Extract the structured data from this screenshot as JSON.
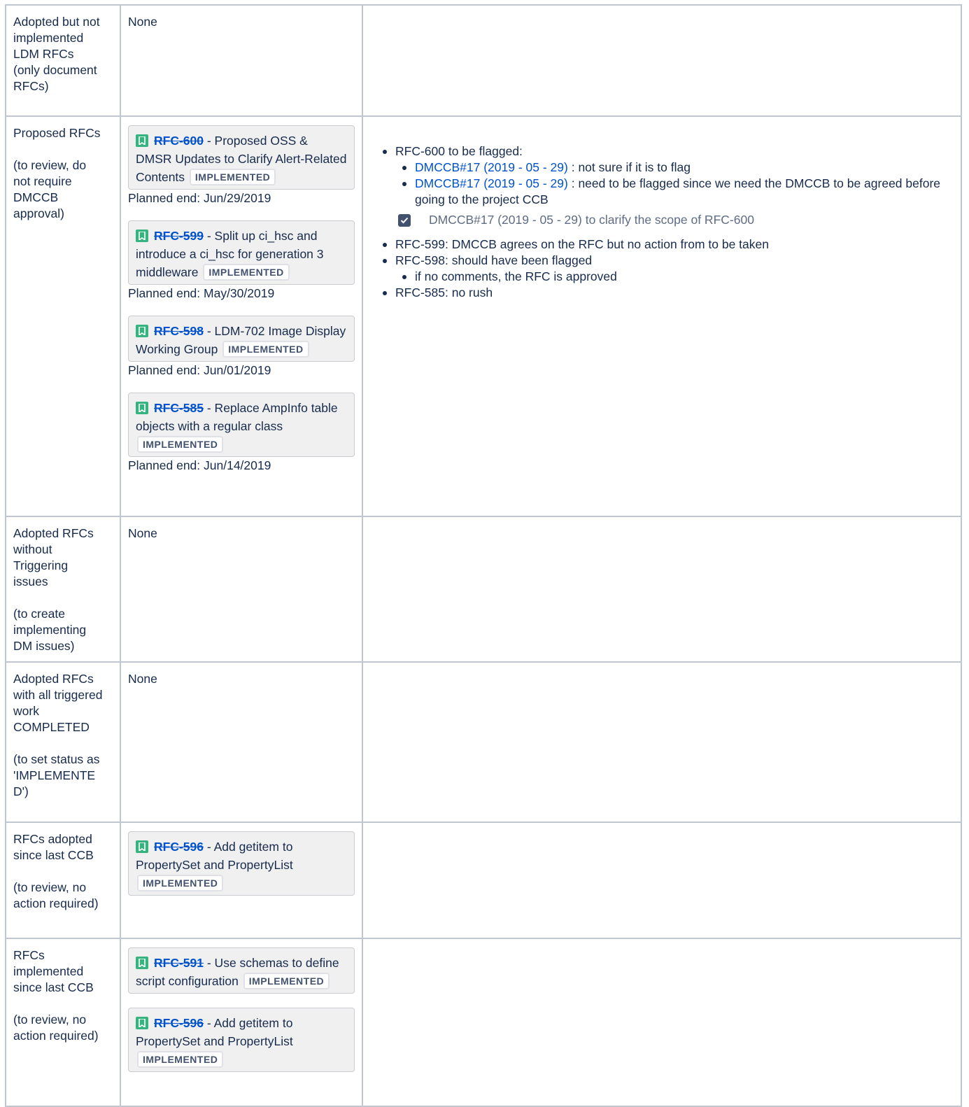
{
  "lozenge": "IMPLEMENTED",
  "rows": {
    "not_impl": {
      "label": [
        "Adopted but not implemented LDM RFCs (only document RFCs)"
      ],
      "content": "None"
    },
    "proposed": {
      "label": [
        "Proposed RFCs",
        "(to review, do not require DMCCB approval)"
      ],
      "cards": [
        {
          "key": "RFC-600",
          "summary": " - Proposed OSS & DMSR Updates to Clarify Alert-Related Contents ",
          "planned": "Planned end: Jun/29/2019"
        },
        {
          "key": "RFC-599",
          "summary": " - Split up ci_hsc and introduce a ci_hsc for generation 3 middleware ",
          "planned": "Planned end: May/30/2019"
        },
        {
          "key": "RFC-598",
          "summary": " - LDM-702 Image Display Working Group ",
          "planned": "Planned end: Jun/01/2019"
        },
        {
          "key": "RFC-585",
          "summary": " - Replace AmpInfo table objects with a regular class ",
          "planned": "Planned end: Jun/14/2019"
        }
      ],
      "notes": {
        "rfc600": "RFC-600 to be flagged:",
        "sub1_link": "DMCCB#17 (2019 - 05 - 29)",
        "sub1_text": " : not sure if it is to flag",
        "sub2_link": "DMCCB#17 (2019 - 05 - 29)",
        "sub2_text": " : need to be flagged since we need the DMCCB to be agreed before going to the project CCB",
        "task": "DMCCB#17 (2019 - 05 - 29) to clarify the scope of RFC-600",
        "rfc599": "RFC-599: DMCCB agrees on the RFC but no action from to be taken",
        "rfc598": "RFC-598: should have been flagged",
        "rfc598_sub": "if no comments, the RFC is approved",
        "rfc585": "RFC-585: no rush"
      }
    },
    "no_trigger": {
      "label": [
        "Adopted RFCs without Triggering issues",
        "(to create implementing DM issues)"
      ],
      "content": "None"
    },
    "completed": {
      "label": [
        "Adopted RFCs with all triggered work COMPLETED",
        "(to set status as 'IMPLEMENTED')"
      ],
      "content": "None"
    },
    "adopted_since": {
      "label": [
        "RFCs adopted since last CCB",
        "(to review, no action required)"
      ],
      "cards": [
        {
          "key": "RFC-596",
          "summary": " - Add getitem to PropertySet and PropertyList "
        }
      ]
    },
    "implemented_since": {
      "label": [
        "RFCs implemented since last CCB",
        "(to review, no action required)"
      ],
      "cards": [
        {
          "key": "RFC-591",
          "summary": " - Use schemas to define script configuration "
        },
        {
          "key": "RFC-596",
          "summary": " - Add getitem to PropertySet and PropertyList "
        }
      ]
    }
  }
}
